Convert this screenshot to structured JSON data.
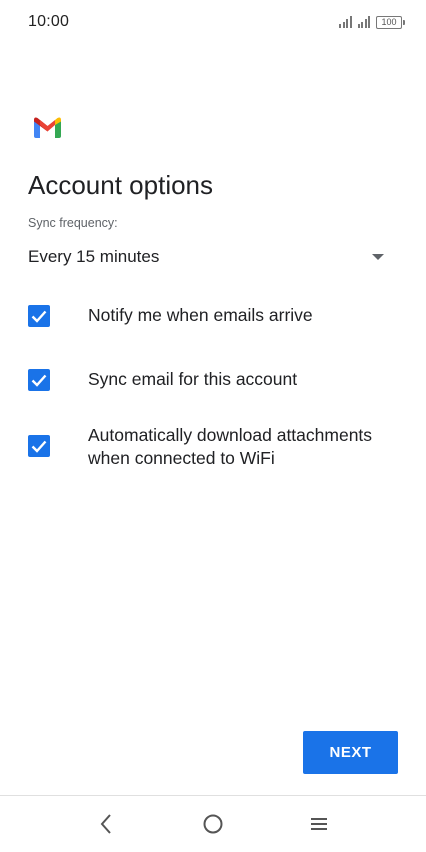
{
  "status_bar": {
    "time": "10:00",
    "battery": "100"
  },
  "app": {
    "logo_icon": "gmail-logo",
    "colors": {
      "accent": "#1a73e8",
      "logo_red": "#ea4335",
      "logo_blue": "#4285f4",
      "logo_green": "#34a853",
      "logo_yellow": "#fbbc04",
      "logo_darkred": "#c5221f"
    }
  },
  "page": {
    "title": "Account options",
    "sync_label": "Sync frequency:",
    "sync_value": "Every 15 minutes"
  },
  "options": [
    {
      "label": "Notify me when emails arrive",
      "checked": true
    },
    {
      "label": "Sync email for this account",
      "checked": true
    },
    {
      "label": "Automatically download attachments when connected to WiFi",
      "checked": true
    }
  ],
  "actions": {
    "next_label": "NEXT"
  },
  "nav": {
    "back_icon": "chevron-left-icon",
    "home_icon": "circle-home-icon",
    "menu_icon": "menu-icon"
  }
}
